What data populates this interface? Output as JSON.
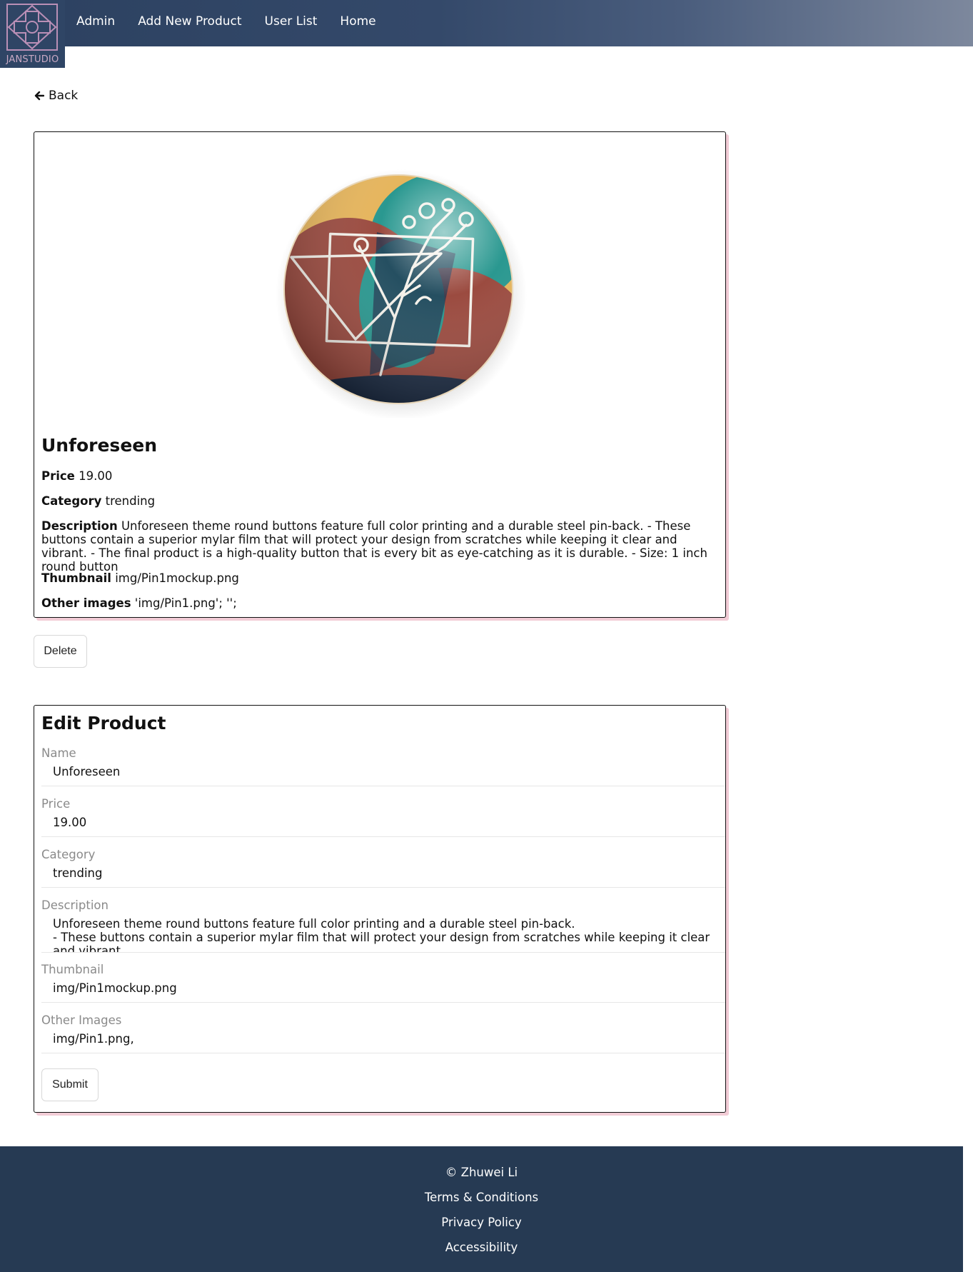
{
  "navbar": {
    "logo_text": "JANSTUDIO",
    "links": [
      "Admin",
      "Add New Product",
      "User List",
      "Home"
    ]
  },
  "back_label": "Back",
  "product": {
    "title": "Unforeseen",
    "price_label": "Price",
    "price": "19.00",
    "category_label": "Category",
    "category": "trending",
    "description_label": "Description",
    "description": "Unforeseen theme round buttons feature full color printing and a durable steel pin-back. - These buttons contain a superior mylar film that will protect your design from scratches while keeping it clear and vibrant. - The final product is a high-quality button that is every bit as eye-catching as it is durable. - Size: 1 inch round button",
    "thumbnail_label": "Thumbnail",
    "thumbnail": "img/Pin1mockup.png",
    "other_images_label": "Other images",
    "other_images": "'img/Pin1.png'; '';"
  },
  "delete_label": "Delete",
  "edit_form": {
    "title": "Edit Product",
    "name_label": "Name",
    "name_value": "Unforeseen",
    "price_label": "Price",
    "price_value": "19.00",
    "category_label": "Category",
    "category_value": "trending",
    "description_label": "Description",
    "description_value": "Unforeseen theme round buttons feature full color printing and a durable steel pin-back.\n- These buttons contain a superior mylar film that will protect your design from scratches while keeping it clear and vibrant.",
    "thumbnail_label": "Thumbnail",
    "thumbnail_value": "img/Pin1mockup.png",
    "other_images_label": "Other Images",
    "other_images_value": "img/Pin1.png,",
    "submit_label": "Submit"
  },
  "footer": {
    "copyright": "© Zhuwei Li",
    "terms": "Terms & Conditions",
    "privacy": "Privacy Policy",
    "accessibility": "Accessibility"
  },
  "colors": {
    "navbar_start": "#2c4160",
    "navbar_end": "#7d889d",
    "footer_bg": "#263a53",
    "card_shadow": "#f2ccd6"
  }
}
